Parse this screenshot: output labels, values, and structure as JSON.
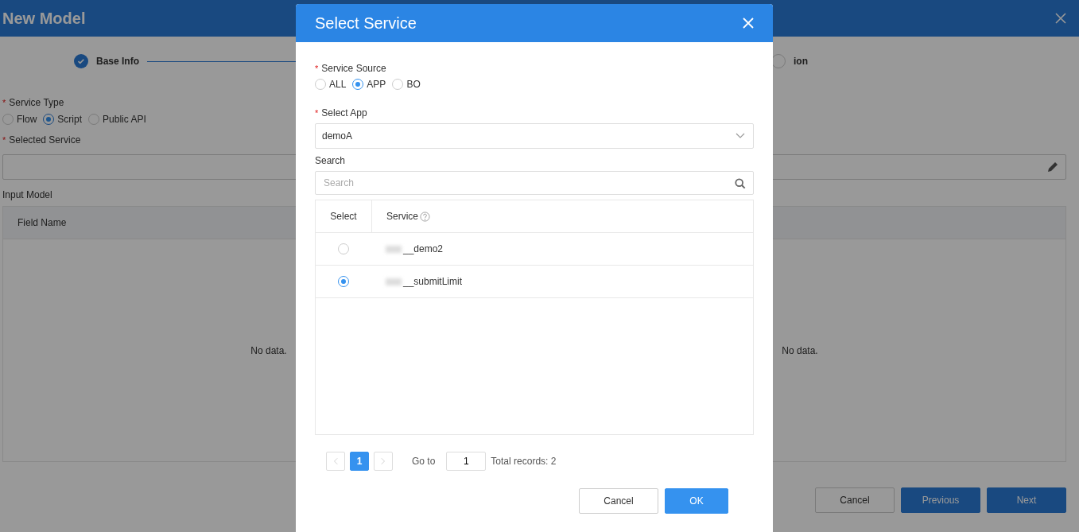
{
  "page": {
    "title": "New Model",
    "steps": [
      {
        "label": "Base Info",
        "done": true
      },
      {
        "label": "ion",
        "done": false
      }
    ],
    "service_type": {
      "label": "Service Type",
      "mark": "*",
      "options": [
        {
          "label": "Flow",
          "selected": false
        },
        {
          "label": "Script",
          "selected": true
        },
        {
          "label": "Public API",
          "selected": false
        }
      ]
    },
    "selected_service": {
      "label": "Selected Service",
      "mark": "*"
    },
    "input_model": {
      "label": "Input Model",
      "columns": [
        "Field Name"
      ],
      "empty_texts": [
        "No data.",
        "No data."
      ]
    },
    "buttons": [
      {
        "label": "Cancel",
        "kind": "default"
      },
      {
        "label": "Previous",
        "kind": "primary"
      },
      {
        "label": "Next",
        "kind": "primary"
      }
    ]
  },
  "dialog": {
    "title": "Select Service",
    "service_source": {
      "label": "Service Source",
      "mark": "*",
      "options": [
        {
          "label": "ALL",
          "selected": false
        },
        {
          "label": "APP",
          "selected": true
        },
        {
          "label": "BO",
          "selected": false
        }
      ]
    },
    "select_app": {
      "label": "Select App",
      "mark": "*",
      "value": "demoA"
    },
    "search": {
      "label": "Search",
      "placeholder": "Search"
    },
    "table": {
      "columns": [
        "Select",
        "Service"
      ],
      "rows": [
        {
          "service": "__demo2",
          "selected": false
        },
        {
          "service": "__submitLimit",
          "selected": true
        }
      ]
    },
    "pagination": {
      "current_page": "1",
      "goto_label": "Go to",
      "goto_value": "1",
      "total": "Total records: 2"
    },
    "buttons": [
      {
        "label": "Cancel",
        "kind": "default"
      },
      {
        "label": "OK",
        "kind": "primary"
      }
    ]
  }
}
